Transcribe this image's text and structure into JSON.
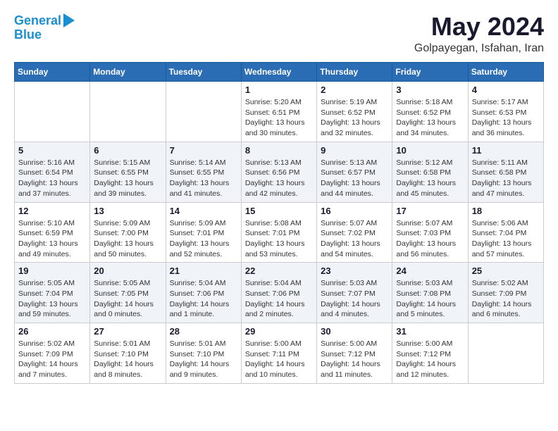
{
  "header": {
    "logo_line1": "General",
    "logo_line2": "Blue",
    "month": "May 2024",
    "location": "Golpayegan, Isfahan, Iran"
  },
  "weekdays": [
    "Sunday",
    "Monday",
    "Tuesday",
    "Wednesday",
    "Thursday",
    "Friday",
    "Saturday"
  ],
  "weeks": [
    [
      {
        "day": "",
        "sunrise": "",
        "sunset": "",
        "daylight": ""
      },
      {
        "day": "",
        "sunrise": "",
        "sunset": "",
        "daylight": ""
      },
      {
        "day": "",
        "sunrise": "",
        "sunset": "",
        "daylight": ""
      },
      {
        "day": "1",
        "sunrise": "Sunrise: 5:20 AM",
        "sunset": "Sunset: 6:51 PM",
        "daylight": "Daylight: 13 hours and 30 minutes."
      },
      {
        "day": "2",
        "sunrise": "Sunrise: 5:19 AM",
        "sunset": "Sunset: 6:52 PM",
        "daylight": "Daylight: 13 hours and 32 minutes."
      },
      {
        "day": "3",
        "sunrise": "Sunrise: 5:18 AM",
        "sunset": "Sunset: 6:52 PM",
        "daylight": "Daylight: 13 hours and 34 minutes."
      },
      {
        "day": "4",
        "sunrise": "Sunrise: 5:17 AM",
        "sunset": "Sunset: 6:53 PM",
        "daylight": "Daylight: 13 hours and 36 minutes."
      }
    ],
    [
      {
        "day": "5",
        "sunrise": "Sunrise: 5:16 AM",
        "sunset": "Sunset: 6:54 PM",
        "daylight": "Daylight: 13 hours and 37 minutes."
      },
      {
        "day": "6",
        "sunrise": "Sunrise: 5:15 AM",
        "sunset": "Sunset: 6:55 PM",
        "daylight": "Daylight: 13 hours and 39 minutes."
      },
      {
        "day": "7",
        "sunrise": "Sunrise: 5:14 AM",
        "sunset": "Sunset: 6:55 PM",
        "daylight": "Daylight: 13 hours and 41 minutes."
      },
      {
        "day": "8",
        "sunrise": "Sunrise: 5:13 AM",
        "sunset": "Sunset: 6:56 PM",
        "daylight": "Daylight: 13 hours and 42 minutes."
      },
      {
        "day": "9",
        "sunrise": "Sunrise: 5:13 AM",
        "sunset": "Sunset: 6:57 PM",
        "daylight": "Daylight: 13 hours and 44 minutes."
      },
      {
        "day": "10",
        "sunrise": "Sunrise: 5:12 AM",
        "sunset": "Sunset: 6:58 PM",
        "daylight": "Daylight: 13 hours and 45 minutes."
      },
      {
        "day": "11",
        "sunrise": "Sunrise: 5:11 AM",
        "sunset": "Sunset: 6:58 PM",
        "daylight": "Daylight: 13 hours and 47 minutes."
      }
    ],
    [
      {
        "day": "12",
        "sunrise": "Sunrise: 5:10 AM",
        "sunset": "Sunset: 6:59 PM",
        "daylight": "Daylight: 13 hours and 49 minutes."
      },
      {
        "day": "13",
        "sunrise": "Sunrise: 5:09 AM",
        "sunset": "Sunset: 7:00 PM",
        "daylight": "Daylight: 13 hours and 50 minutes."
      },
      {
        "day": "14",
        "sunrise": "Sunrise: 5:09 AM",
        "sunset": "Sunset: 7:01 PM",
        "daylight": "Daylight: 13 hours and 52 minutes."
      },
      {
        "day": "15",
        "sunrise": "Sunrise: 5:08 AM",
        "sunset": "Sunset: 7:01 PM",
        "daylight": "Daylight: 13 hours and 53 minutes."
      },
      {
        "day": "16",
        "sunrise": "Sunrise: 5:07 AM",
        "sunset": "Sunset: 7:02 PM",
        "daylight": "Daylight: 13 hours and 54 minutes."
      },
      {
        "day": "17",
        "sunrise": "Sunrise: 5:07 AM",
        "sunset": "Sunset: 7:03 PM",
        "daylight": "Daylight: 13 hours and 56 minutes."
      },
      {
        "day": "18",
        "sunrise": "Sunrise: 5:06 AM",
        "sunset": "Sunset: 7:04 PM",
        "daylight": "Daylight: 13 hours and 57 minutes."
      }
    ],
    [
      {
        "day": "19",
        "sunrise": "Sunrise: 5:05 AM",
        "sunset": "Sunset: 7:04 PM",
        "daylight": "Daylight: 13 hours and 59 minutes."
      },
      {
        "day": "20",
        "sunrise": "Sunrise: 5:05 AM",
        "sunset": "Sunset: 7:05 PM",
        "daylight": "Daylight: 14 hours and 0 minutes."
      },
      {
        "day": "21",
        "sunrise": "Sunrise: 5:04 AM",
        "sunset": "Sunset: 7:06 PM",
        "daylight": "Daylight: 14 hours and 1 minute."
      },
      {
        "day": "22",
        "sunrise": "Sunrise: 5:04 AM",
        "sunset": "Sunset: 7:06 PM",
        "daylight": "Daylight: 14 hours and 2 minutes."
      },
      {
        "day": "23",
        "sunrise": "Sunrise: 5:03 AM",
        "sunset": "Sunset: 7:07 PM",
        "daylight": "Daylight: 14 hours and 4 minutes."
      },
      {
        "day": "24",
        "sunrise": "Sunrise: 5:03 AM",
        "sunset": "Sunset: 7:08 PM",
        "daylight": "Daylight: 14 hours and 5 minutes."
      },
      {
        "day": "25",
        "sunrise": "Sunrise: 5:02 AM",
        "sunset": "Sunset: 7:09 PM",
        "daylight": "Daylight: 14 hours and 6 minutes."
      }
    ],
    [
      {
        "day": "26",
        "sunrise": "Sunrise: 5:02 AM",
        "sunset": "Sunset: 7:09 PM",
        "daylight": "Daylight: 14 hours and 7 minutes."
      },
      {
        "day": "27",
        "sunrise": "Sunrise: 5:01 AM",
        "sunset": "Sunset: 7:10 PM",
        "daylight": "Daylight: 14 hours and 8 minutes."
      },
      {
        "day": "28",
        "sunrise": "Sunrise: 5:01 AM",
        "sunset": "Sunset: 7:10 PM",
        "daylight": "Daylight: 14 hours and 9 minutes."
      },
      {
        "day": "29",
        "sunrise": "Sunrise: 5:00 AM",
        "sunset": "Sunset: 7:11 PM",
        "daylight": "Daylight: 14 hours and 10 minutes."
      },
      {
        "day": "30",
        "sunrise": "Sunrise: 5:00 AM",
        "sunset": "Sunset: 7:12 PM",
        "daylight": "Daylight: 14 hours and 11 minutes."
      },
      {
        "day": "31",
        "sunrise": "Sunrise: 5:00 AM",
        "sunset": "Sunset: 7:12 PM",
        "daylight": "Daylight: 14 hours and 12 minutes."
      },
      {
        "day": "",
        "sunrise": "",
        "sunset": "",
        "daylight": ""
      }
    ]
  ]
}
